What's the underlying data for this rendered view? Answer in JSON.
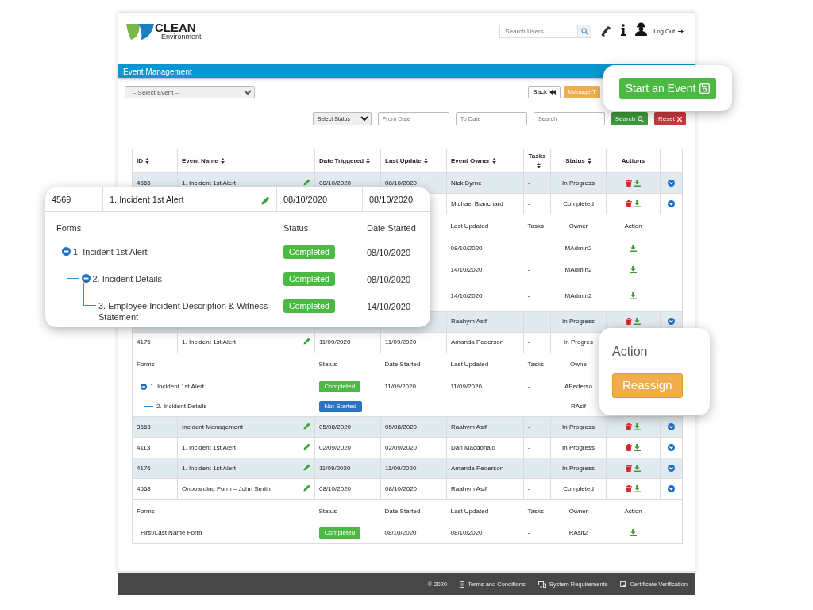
{
  "header": {
    "logo_title": "CLEAN",
    "logo_subtitle": "Environment",
    "search_placeholder": "Search Users",
    "logout": "Log Out"
  },
  "section_title": "Event Management",
  "event_select": "-- Select Event --",
  "back_button": "Back",
  "manage_button": "Manage T",
  "filters": {
    "status_select": "Select Status",
    "from_placeholder": "From Date",
    "to_placeholder": "To Date",
    "search_placeholder": "Search",
    "search_button": "Search",
    "reset_button": "Reset"
  },
  "table": {
    "columns": [
      {
        "label": "ID",
        "sortable": true
      },
      {
        "label": "Event Name",
        "sortable": true
      },
      {
        "label": "Date Triggered",
        "sortable": true
      },
      {
        "label": "Last Update",
        "sortable": true
      },
      {
        "label": "Event Owner",
        "sortable": true
      },
      {
        "label": "Tasks",
        "sortable": true
      },
      {
        "label": "Status",
        "sortable": true
      },
      {
        "label": "Actions",
        "sortable": false
      }
    ],
    "rows": [
      {
        "kind": "event",
        "id": "4565",
        "name": "1. Incident 1st Alert",
        "editable": true,
        "date_triggered": "08/10/2020",
        "last_update": "08/10/2020",
        "owner": "Nick Byrne",
        "tasks": "-",
        "status": "In Progress",
        "delete": true,
        "download": true,
        "expand": true
      },
      {
        "kind": "event",
        "owner": "Michael Blanchard",
        "tasks": "-",
        "status": "Completed",
        "delete": true,
        "download": true,
        "expand": true
      },
      {
        "kind": "forms",
        "headers": {
          "last_updated": "Last Updated",
          "tasks": "Tasks",
          "owner": "Owner",
          "action": "Action"
        },
        "forms": [
          {
            "last_updated": "08/10/2020",
            "tasks": "-",
            "owner": "MAdmin2",
            "download": true
          },
          {
            "last_updated": "14/10/2020",
            "tasks": "-",
            "owner": "MAdmin2",
            "download": true
          },
          {
            "last_updated": "14/10/2020",
            "tasks": "-",
            "owner": "MAdmin2",
            "download": true
          }
        ]
      },
      {
        "kind": "event",
        "owner": "Raahym Asif",
        "tasks": "-",
        "status": "In Progress",
        "delete": true,
        "download": true,
        "expand": true
      },
      {
        "kind": "event",
        "id": "4175",
        "name": "1. Incident 1st Alert",
        "editable": true,
        "date_triggered": "11/09/2020",
        "last_update": "11/09/2020",
        "owner": "Amanda Pederson",
        "tasks": "-",
        "status": "In Progres",
        "expand": false
      },
      {
        "kind": "forms",
        "headers": {
          "forms": "Forms",
          "status": "Status",
          "date_started": "Date Started",
          "last_updated": "Last Updated",
          "tasks": "Tasks",
          "owner": "Owne"
        },
        "forms": [
          {
            "name": "1. Incident 1st Alert",
            "expanded": true,
            "status": {
              "text": "Completed",
              "color": "#4cb944"
            },
            "date_started": "11/09/2020",
            "last_updated": "11/09/2020",
            "tasks": "-",
            "owner": "APederso",
            "children": [
              {
                "name": "2. Incident Details",
                "expanded": false,
                "status": {
                  "text": "Not Started",
                  "color": "#2a73c0"
                },
                "tasks": "-",
                "owner": "RAsif"
              }
            ]
          }
        ]
      },
      {
        "kind": "event",
        "id": "3663",
        "name": "Incident Management",
        "editable": true,
        "date_triggered": "05/08/2020",
        "last_update": "05/08/2020",
        "owner": "Raahym Asif",
        "tasks": "-",
        "status": "In Progress",
        "delete": true,
        "download": true,
        "expand": true
      },
      {
        "kind": "event",
        "id": "4113",
        "name": "1. Incident 1st Alert",
        "editable": true,
        "date_triggered": "02/09/2020",
        "last_update": "02/09/2020",
        "owner": "Dan Macdonald",
        "tasks": "-",
        "status": "In Progress",
        "delete": true,
        "download": true,
        "expand": true
      },
      {
        "kind": "event",
        "id": "4176",
        "name": "1. Incident 1st Alert",
        "editable": true,
        "date_triggered": "11/09/2020",
        "last_update": "11/09/2020",
        "owner": "Amanda Pederson",
        "tasks": "-",
        "status": "In Progress",
        "delete": true,
        "download": true,
        "expand": true
      },
      {
        "kind": "event",
        "id": "4568",
        "name": "Onboarding Form – John Smith",
        "editable": true,
        "date_triggered": "08/10/2020",
        "last_update": "08/10/2020",
        "owner": "Raahym Asif",
        "tasks": "-",
        "status": "Completed",
        "delete": true,
        "download": true,
        "expand": true
      },
      {
        "kind": "forms",
        "headers": {
          "forms": "Forms",
          "status": "Status",
          "date_started": "Date Started",
          "last_updated": "Last Updated",
          "tasks": "Tasks",
          "owner": "Owner",
          "action": "Action"
        },
        "forms": [
          {
            "name": "First/Last Name Form",
            "expanded": false,
            "status": {
              "text": "Completed",
              "color": "#4cb944"
            },
            "date_started": "08/10/2020",
            "last_updated": "08/10/2020",
            "tasks": "-",
            "owner": "RAsif2",
            "download": true
          }
        ]
      }
    ]
  },
  "footer": [
    {
      "kind": "copyright",
      "text": "© 2020"
    },
    {
      "kind": "terms",
      "text": "Terms and Conditions"
    },
    {
      "kind": "requirements",
      "text": "System Requirements"
    },
    {
      "kind": "certificate",
      "text": "Certificate Verification"
    }
  ],
  "detail_popup": {
    "row": {
      "id": "4569",
      "name": "1. Incident 1st Alert",
      "editable": true,
      "date_triggered": "08/10/2020",
      "last_update": "08/10/2020"
    },
    "headers": {
      "forms": "Forms",
      "status": "Status",
      "date_started": "Date Started"
    },
    "forms": [
      {
        "name": "1. Incident 1st Alert",
        "expanded": true,
        "status": {
          "text": "Completed",
          "color": "#4cb944"
        },
        "date_started": "08/10/2020",
        "children": [
          {
            "name": "2. Incident Details",
            "expanded": true,
            "status": {
              "text": "Completed",
              "color": "#4cb944"
            },
            "date_started": "08/10/2020",
            "children": [
              {
                "name": "3. Employee Incident Description & Witness Statement",
                "expanded": false,
                "status": {
                  "text": "Completed",
                  "color": "#4cb944"
                },
                "date_started": "14/10/2020"
              }
            ]
          }
        ]
      }
    ]
  },
  "start_popup": {
    "button": "Start an Event"
  },
  "action_popup": {
    "label": "Action",
    "button": "Reassign"
  }
}
